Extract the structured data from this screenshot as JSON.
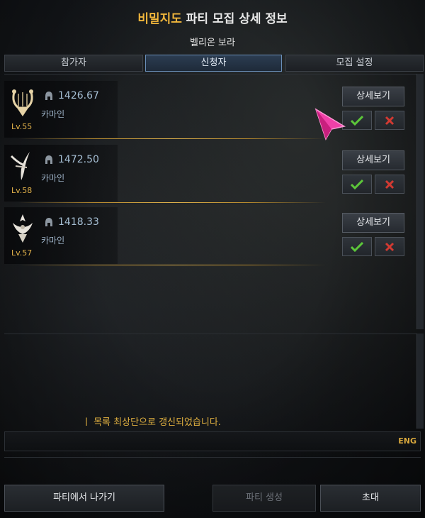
{
  "header": {
    "title_highlight": "비밀지도",
    "title_rest": " 파티 모집 상세 정보",
    "subtitle": "벨리온 보라"
  },
  "tabs": [
    {
      "label": "참가자",
      "active": false
    },
    {
      "label": "신청자",
      "active": true
    },
    {
      "label": "모집 설정",
      "active": false
    }
  ],
  "applicants": [
    {
      "level": "Lv.55",
      "gear_score": "1426.67",
      "server": "카마인",
      "class_icon": "bard-harp-icon",
      "detail_label": "상세보기"
    },
    {
      "level": "Lv.58",
      "gear_score": "1472.50",
      "server": "카마인",
      "class_icon": "blade-icon",
      "detail_label": "상세보기"
    },
    {
      "level": "Lv.57",
      "gear_score": "1418.33",
      "server": "카마인",
      "class_icon": "crest-icon",
      "detail_label": "상세보기"
    }
  ],
  "chat": {
    "notice": "ㅣ 목록 최상단으로 갱신되었습니다.",
    "ime": "ENG"
  },
  "footer": {
    "leave_label": "파티에서 나가기",
    "create_label": "파티 생성",
    "invite_label": "초대"
  },
  "colors": {
    "accent_gold": "#f0b63c",
    "accept_green": "#5cc63a",
    "reject_red": "#d23a32",
    "tab_active_border": "#6a8fb8"
  }
}
